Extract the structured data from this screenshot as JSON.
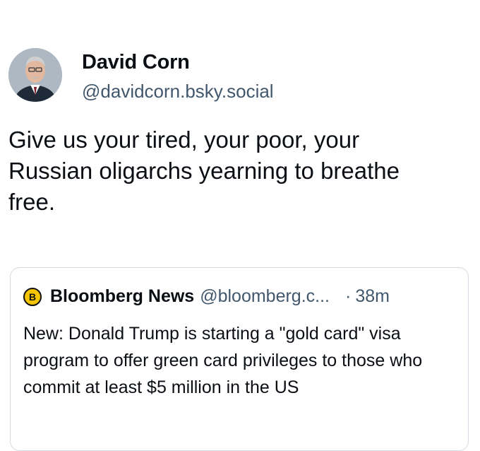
{
  "author": {
    "name": "David Corn",
    "handle": "@davidcorn.bsky.social"
  },
  "post": {
    "text": "Give us your tired, your poor, your\nRussian oligarchs yearning to breathe\nfree."
  },
  "quote": {
    "avatar_letter": "B",
    "avatar_color": "#f5c400",
    "name": "Bloomberg News",
    "handle": "@bloomberg.c...",
    "separator": "·",
    "time": "38m",
    "text": "New: Donald Trump is starting a \"gold card\" visa program to offer green card privileges to those who commit at least $5 million in the US"
  },
  "colors": {
    "text": "#0b0f14",
    "muted": "#42576c",
    "border": "#d4dbe2"
  }
}
